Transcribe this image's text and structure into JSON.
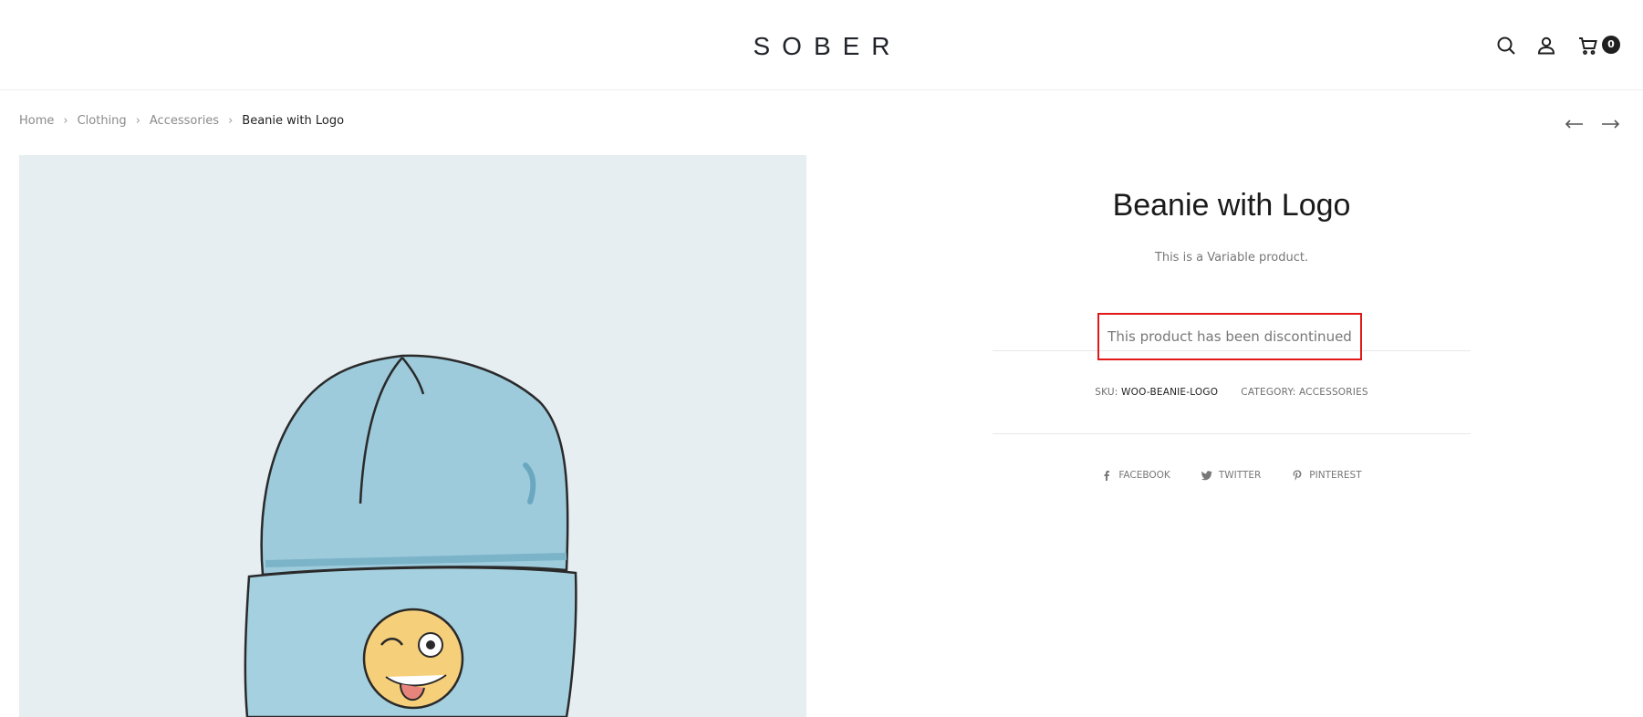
{
  "header": {
    "logo": "SOBER",
    "cart_count": "0",
    "icons": [
      "search-icon",
      "user-icon",
      "cart-icon"
    ]
  },
  "breadcrumb": {
    "items": [
      "Home",
      "Clothing",
      "Accessories"
    ],
    "current": "Beanie with Logo"
  },
  "product": {
    "title": "Beanie with Logo",
    "description": "This is a Variable product.",
    "notice": "This product has been discontinued",
    "sku_label": "SKU:",
    "sku_value": "WOO-BEANIE-LOGO",
    "category_label": "CATEGORY:",
    "category_value": "ACCESSORIES"
  },
  "share": {
    "facebook": "FACEBOOK",
    "twitter": "TWITTER",
    "pinterest": "PINTEREST"
  },
  "colors": {
    "notice_border": "#e01818",
    "image_bg": "#e6eef1",
    "beanie": "#9dcbdc"
  }
}
